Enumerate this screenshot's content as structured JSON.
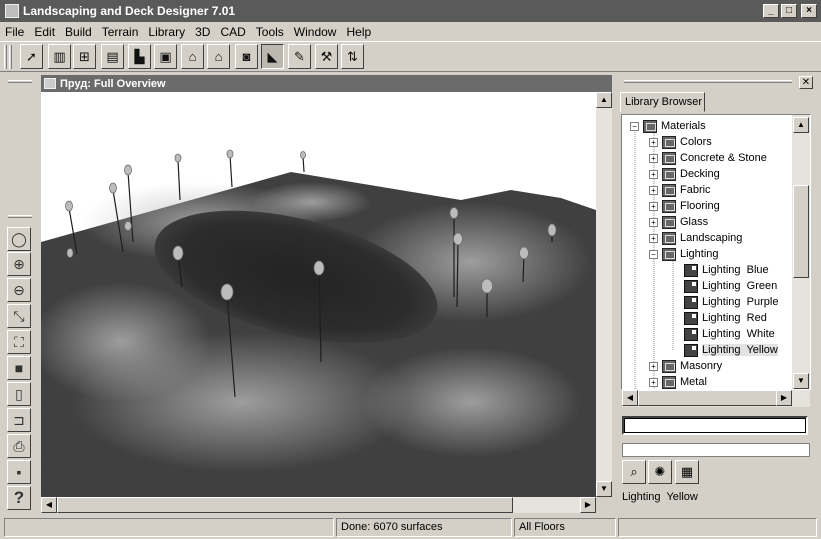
{
  "window": {
    "title": "Landscaping and Deck Designer 7.01"
  },
  "menu": [
    "File",
    "Edit",
    "Build",
    "Terrain",
    "Library",
    "3D",
    "CAD",
    "Tools",
    "Window",
    "Help"
  ],
  "toolbar": {
    "icons": [
      "pointer-icon",
      "door-icon",
      "window-icon",
      "library-icon",
      "fireplace-icon",
      "appliance-icon",
      "house-icon",
      "house-alt-icon",
      "camera-icon",
      "terrain-icon",
      "pencil-icon",
      "wrench-icon",
      "elevation-icon"
    ]
  },
  "left_toolbox": {
    "icons": [
      "zoom-window-icon",
      "zoom-in-icon",
      "zoom-out-icon",
      "zoom-fit-icon",
      "fill-window-icon",
      "render-icon",
      "new-document-icon",
      "open-folder-icon",
      "print-icon",
      "save-icon",
      "help-icon"
    ],
    "help_glyph": "?"
  },
  "viewport": {
    "title": "Пруд: Full Overview"
  },
  "library": {
    "tab_label": "Library Browser",
    "close_glyph": "✕",
    "tree": [
      {
        "label": "Materials",
        "level": 0,
        "expander": "−",
        "kind": "folder"
      },
      {
        "label": "Colors",
        "level": 1,
        "expander": "+",
        "kind": "folder"
      },
      {
        "label": "Concrete & Stone",
        "level": 1,
        "expander": "+",
        "kind": "folder"
      },
      {
        "label": "Decking",
        "level": 1,
        "expander": "+",
        "kind": "folder"
      },
      {
        "label": "Fabric",
        "level": 1,
        "expander": "+",
        "kind": "folder"
      },
      {
        "label": "Flooring",
        "level": 1,
        "expander": "+",
        "kind": "folder"
      },
      {
        "label": "Glass",
        "level": 1,
        "expander": "+",
        "kind": "folder"
      },
      {
        "label": "Landscaping",
        "level": 1,
        "expander": "+",
        "kind": "folder"
      },
      {
        "label": "Lighting",
        "level": 1,
        "expander": "−",
        "kind": "folder"
      },
      {
        "label": "Lighting  Blue",
        "level": 2,
        "expander": "",
        "kind": "item"
      },
      {
        "label": "Lighting  Green",
        "level": 2,
        "expander": "",
        "kind": "item"
      },
      {
        "label": "Lighting  Purple",
        "level": 2,
        "expander": "",
        "kind": "item"
      },
      {
        "label": "Lighting  Red",
        "level": 2,
        "expander": "",
        "kind": "item"
      },
      {
        "label": "Lighting  White",
        "level": 2,
        "expander": "",
        "kind": "item"
      },
      {
        "label": "Lighting  Yellow",
        "level": 2,
        "expander": "",
        "kind": "item",
        "selected": true
      },
      {
        "label": "Masonry",
        "level": 1,
        "expander": "+",
        "kind": "folder"
      },
      {
        "label": "Metal",
        "level": 1,
        "expander": "+",
        "kind": "folder"
      }
    ],
    "search_value": "",
    "panel_buttons": [
      "library-search-icon",
      "library-find-icon",
      "library-add-icon"
    ],
    "selected_name": "Lighting  Yellow"
  },
  "status": {
    "message": "",
    "surfaces": "Done:  6070 surfaces",
    "floors": "All Floors"
  },
  "colors": {
    "titlebar": "#5a5a5a",
    "face": "#d4d0c8",
    "terrain": "#3d3d3d"
  }
}
